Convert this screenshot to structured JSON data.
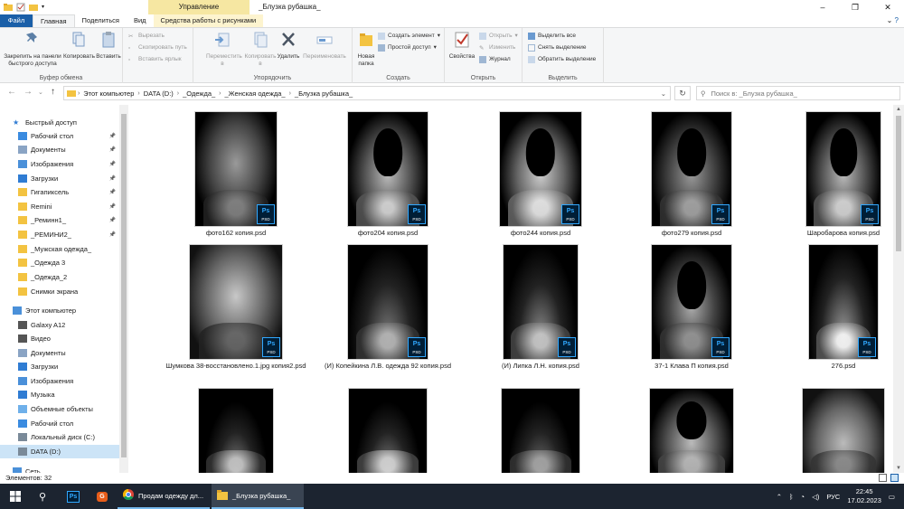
{
  "window": {
    "context_tab": "Управление",
    "title": "_Блузка рубашка_",
    "controls": [
      "–",
      "❐",
      "✕"
    ]
  },
  "tabs": [
    {
      "label": "Файл"
    },
    {
      "label": "Главная"
    },
    {
      "label": "Поделиться"
    },
    {
      "label": "Вид"
    },
    {
      "label": "Средства работы с рисунками"
    }
  ],
  "ribbon": {
    "clipboard": {
      "label": "Буфер обмена",
      "pin": "Закрепить на панели быстрого доступа",
      "copy": "Копировать",
      "paste": "Вставить",
      "cut": "Вырезать",
      "copy_path": "Скопировать путь",
      "paste_shortcut": "Вставить ярлык"
    },
    "organize": {
      "label": "Упорядочить",
      "move_to": "Переместить в",
      "copy_to": "Копировать в",
      "delete": "Удалить",
      "rename": "Переименовать"
    },
    "new": {
      "label": "Создать",
      "new_folder": "Новая папка",
      "new_item": "Создать элемент",
      "easy_access": "Простой доступ"
    },
    "open": {
      "label": "Открыть",
      "properties": "Свойства",
      "open": "Открыть",
      "edit": "Изменить",
      "history": "Журнал"
    },
    "select": {
      "label": "Выделить",
      "select_all": "Выделить все",
      "select_none": "Снять выделение",
      "invert": "Обратить выделение"
    }
  },
  "address": {
    "crumbs": [
      "Этот компьютер",
      "DATA (D:)",
      "_Одежда_",
      "_Женская одежда_",
      "_Блузка рубашка_"
    ],
    "search_placeholder": "Поиск в: _Блузка рубашка_"
  },
  "nav": [
    {
      "label": "Быстрый доступ",
      "icon": "star-icon",
      "pinned": false,
      "level": 0
    },
    {
      "label": "Рабочий стол",
      "icon": "desktop-icon",
      "pinned": true,
      "level": 1
    },
    {
      "label": "Документы",
      "icon": "documents-icon",
      "pinned": true,
      "level": 1
    },
    {
      "label": "Изображения",
      "icon": "pictures-icon",
      "pinned": true,
      "level": 1
    },
    {
      "label": "Загрузки",
      "icon": "download-icon",
      "pinned": true,
      "level": 1
    },
    {
      "label": "Гигапиксель",
      "icon": "folder-icon",
      "pinned": true,
      "level": 1
    },
    {
      "label": "Remini",
      "icon": "folder-icon",
      "pinned": true,
      "level": 1
    },
    {
      "label": "_Реминн1_",
      "icon": "folder-icon",
      "pinned": true,
      "level": 1
    },
    {
      "label": "_РЕМИНИ2_",
      "icon": "folder-icon",
      "pinned": true,
      "level": 1
    },
    {
      "label": "_Мужская одежда_",
      "icon": "folder-icon",
      "pinned": false,
      "level": 1
    },
    {
      "label": "_Одежда 3",
      "icon": "folder-icon",
      "pinned": false,
      "level": 1
    },
    {
      "label": "_Одежда_2",
      "icon": "folder-icon",
      "pinned": false,
      "level": 1
    },
    {
      "label": "Снимки экрана",
      "icon": "folder-icon",
      "pinned": false,
      "level": 1
    },
    {
      "label": "Этот компьютер",
      "icon": "computer-icon",
      "pinned": false,
      "level": 0
    },
    {
      "label": "Galaxy A12",
      "icon": "phone-icon",
      "pinned": false,
      "level": 1
    },
    {
      "label": "Видео",
      "icon": "video-icon",
      "pinned": false,
      "level": 1
    },
    {
      "label": "Документы",
      "icon": "documents-icon",
      "pinned": false,
      "level": 1
    },
    {
      "label": "Загрузки",
      "icon": "download-icon",
      "pinned": false,
      "level": 1
    },
    {
      "label": "Изображения",
      "icon": "pictures-icon",
      "pinned": false,
      "level": 1
    },
    {
      "label": "Музыка",
      "icon": "music-icon",
      "pinned": false,
      "level": 1
    },
    {
      "label": "Объемные объекты",
      "icon": "3d-objects-icon",
      "pinned": false,
      "level": 1
    },
    {
      "label": "Рабочий стол",
      "icon": "desktop-icon",
      "pinned": false,
      "level": 1
    },
    {
      "label": "Локальный диск (C:)",
      "icon": "drive-icon",
      "pinned": false,
      "level": 1
    },
    {
      "label": "DATA (D:)",
      "icon": "drive-icon",
      "pinned": false,
      "level": 1,
      "selected": true
    },
    {
      "label": "Сеть",
      "icon": "network-icon",
      "pinned": false,
      "level": 0
    }
  ],
  "files": [
    {
      "name": "фото162 копия.psd",
      "badge": "Ps",
      "badge_sub": "PSD"
    },
    {
      "name": "фото204 копия.psd",
      "badge": "Ps",
      "badge_sub": "PSD"
    },
    {
      "name": "фото244 копия.psd",
      "badge": "Ps",
      "badge_sub": "PSD"
    },
    {
      "name": "фото279 копия.psd",
      "badge": "Ps",
      "badge_sub": "PSD"
    },
    {
      "name": "Шаробарова копия.psd",
      "badge": "Ps",
      "badge_sub": "PSD"
    },
    {
      "name": "Шумкова 38-восстановлено.1.jpg копия2.psd",
      "badge": "Ps",
      "badge_sub": "PSD"
    },
    {
      "name": "(И) Копейкина Л.В. одежда 92 копия.psd",
      "badge": "Ps",
      "badge_sub": "PSD"
    },
    {
      "name": "(И) Липка Л.Н. копия.psd",
      "badge": "Ps",
      "badge_sub": "PSD"
    },
    {
      "name": "37-1 Клава П копия.psd",
      "badge": "Ps",
      "badge_sub": "PSD"
    },
    {
      "name": "276.psd",
      "badge": "Ps",
      "badge_sub": "PSD"
    },
    {
      "name": "",
      "badge": "",
      "badge_sub": ""
    },
    {
      "name": "",
      "badge": "",
      "badge_sub": ""
    },
    {
      "name": "",
      "badge": "",
      "badge_sub": ""
    },
    {
      "name": "",
      "badge": "",
      "badge_sub": ""
    },
    {
      "name": "",
      "badge": "",
      "badge_sub": ""
    }
  ],
  "status": {
    "count": "Элементов: 32"
  },
  "taskbar": {
    "apps": [
      {
        "icon": "windows-start-icon"
      },
      {
        "icon": "search-icon"
      },
      {
        "icon": "photoshop-icon",
        "badge": "Ps"
      },
      {
        "icon": "browser-shield-icon",
        "badge": "G"
      },
      {
        "icon": "chrome-icon",
        "label": "Продам одежду дл..."
      },
      {
        "icon": "folder-icon",
        "label": "_Блузка рубашка_"
      }
    ],
    "lang": "РУС",
    "time": "22:45",
    "date": "17.02.2023",
    "colors": {
      "accent": "#76b9ed",
      "bar": "#1c2430"
    }
  }
}
